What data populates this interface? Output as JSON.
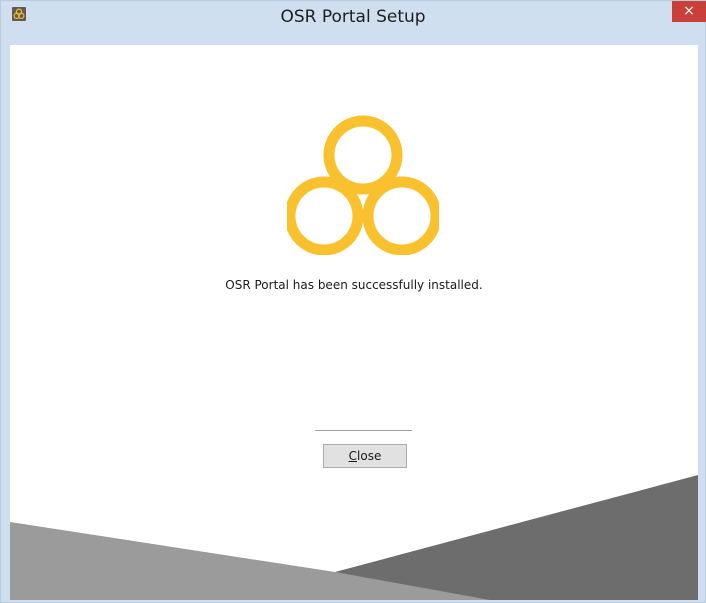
{
  "window": {
    "title": "OSR Portal Setup",
    "app_icon": "osr-logo-icon",
    "close_glyph": "×"
  },
  "main": {
    "logo": "osr-trefoil-logo",
    "message": "OSR Portal has been successfully installed.",
    "close_button": {
      "mnemonic": "C",
      "rest": "lose"
    }
  },
  "colors": {
    "logo_yellow": "#f9c12e",
    "titlebar": "#cfdff0",
    "close_red": "#c93f3a",
    "footer_light_gray": "#9b9b9b",
    "footer_dark_gray": "#6d6d6d"
  }
}
